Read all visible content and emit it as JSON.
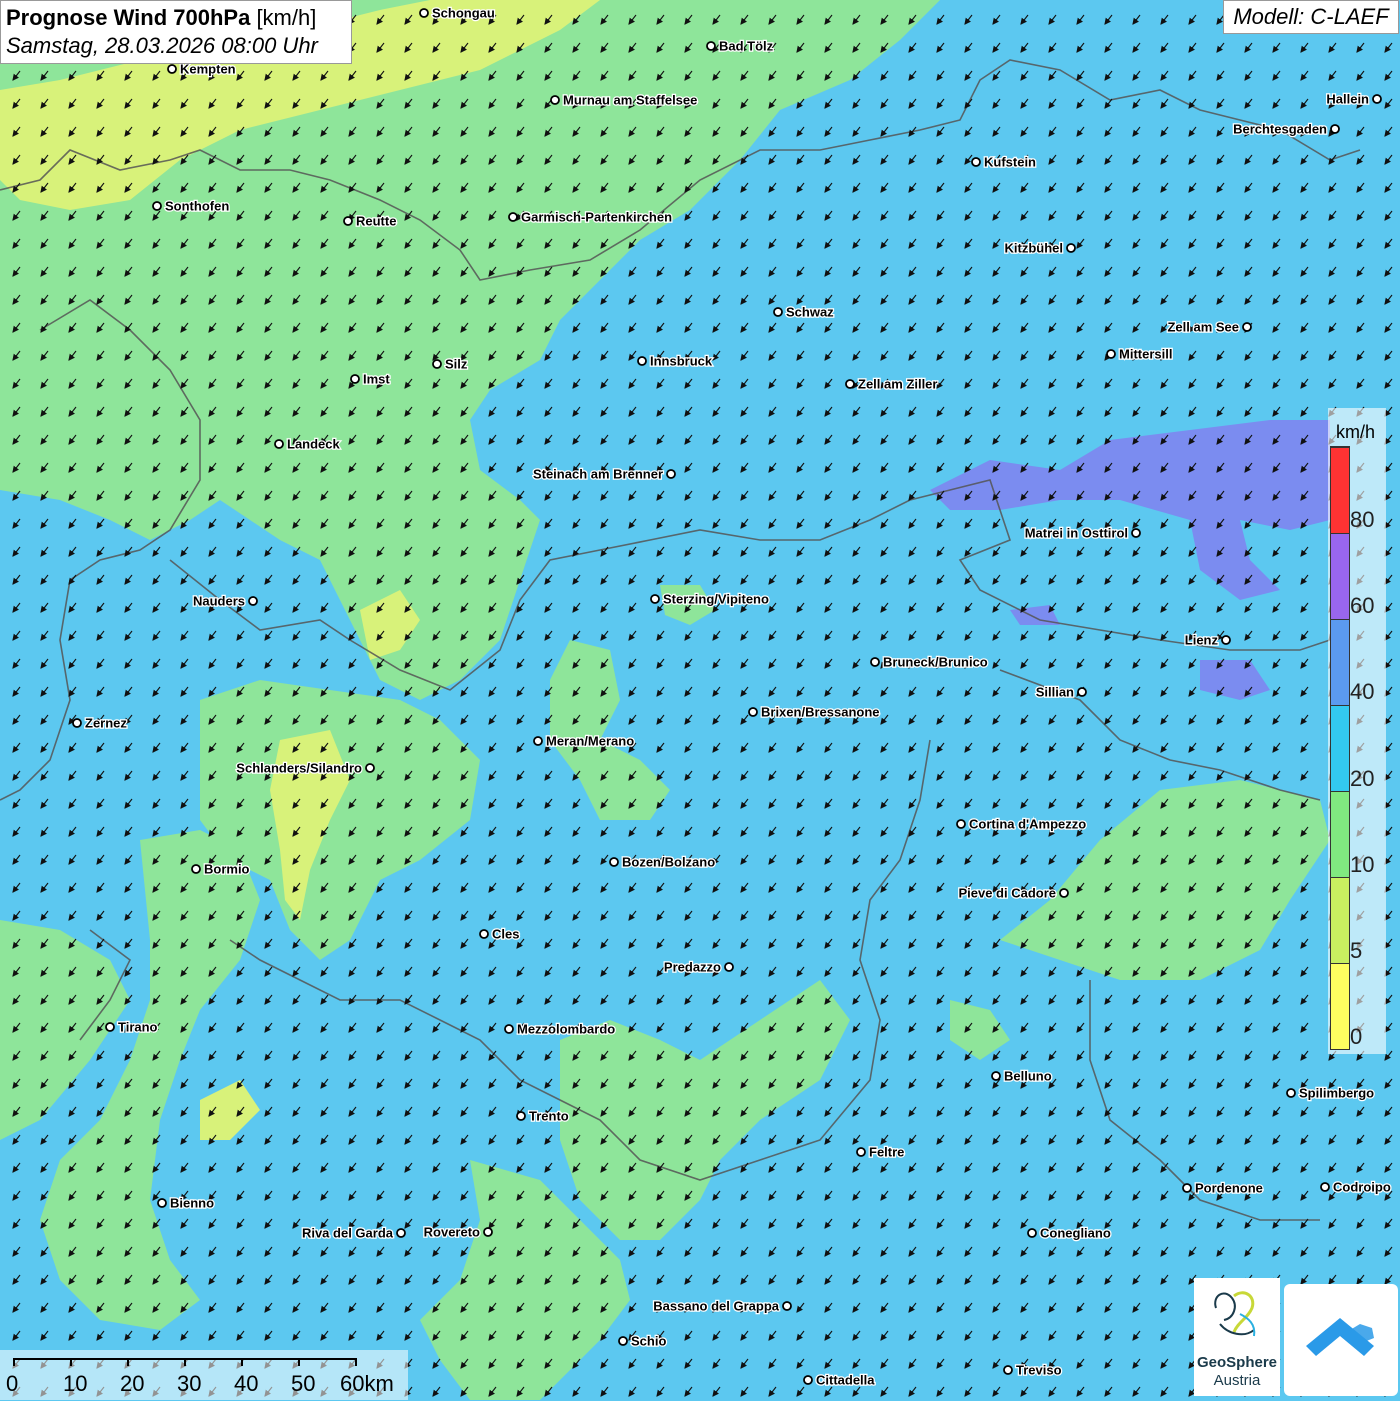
{
  "header": {
    "title_bold": "Prognose Wind 700hPa",
    "title_unit": "[km/h]",
    "datetime": "Samstag, 28.03.2026 08:00 Uhr",
    "model": "Modell: C-LAEF"
  },
  "legend": {
    "unit": "km/h",
    "labels": [
      "80",
      "60",
      "40",
      "20",
      "10",
      "5",
      "0"
    ],
    "colors": [
      "#ff3333",
      "#9966ee",
      "#5b9af0",
      "#33c8f0",
      "#80e880",
      "#c8f060",
      "#ffff60"
    ]
  },
  "scale_bar": {
    "labels": [
      "0",
      "10",
      "20",
      "30",
      "40",
      "50",
      "60km"
    ]
  },
  "logo": {
    "line1": "GeoSphere",
    "line2": "Austria"
  },
  "colors": {
    "wind_10_20": "#5cc8f0",
    "wind_5_10": "#8ee59a",
    "wind_0_5": "#d8f27a",
    "wind_40_60": "#7b8cf0",
    "border": "#555555",
    "arrow": "#111111"
  },
  "cities": [
    {
      "name": "Schongau"
    },
    {
      "name": "Bad Tölz"
    },
    {
      "name": "Kempten"
    },
    {
      "name": "Murnau am Staffelsee"
    },
    {
      "name": "Hallein"
    },
    {
      "name": "Berchtesgaden"
    },
    {
      "name": "Kufstein"
    },
    {
      "name": "Sonthofen"
    },
    {
      "name": "Reutte"
    },
    {
      "name": "Garmisch-Partenkirchen"
    },
    {
      "name": "Kitzbühel"
    },
    {
      "name": "Schwaz"
    },
    {
      "name": "Zell am See"
    },
    {
      "name": "Mittersill"
    },
    {
      "name": "Innsbruck"
    },
    {
      "name": "Silz"
    },
    {
      "name": "Imst"
    },
    {
      "name": "Zell am Ziller"
    },
    {
      "name": "Landeck"
    },
    {
      "name": "Steinach am Brenner"
    },
    {
      "name": "Matrei in Osttirol"
    },
    {
      "name": "Nauders"
    },
    {
      "name": "Sterzing/Vipiteno"
    },
    {
      "name": "Lienz"
    },
    {
      "name": "Bruneck/Brunico"
    },
    {
      "name": "Sillian"
    },
    {
      "name": "Brixen/Bressanone"
    },
    {
      "name": "Zernez"
    },
    {
      "name": "Meran/Merano"
    },
    {
      "name": "Schlanders/Silandro"
    },
    {
      "name": "Cortina d'Ampezzo"
    },
    {
      "name": "Bozen/Bolzano"
    },
    {
      "name": "Bormio"
    },
    {
      "name": "Pieve di Cadore"
    },
    {
      "name": "Cles"
    },
    {
      "name": "Predazzo"
    },
    {
      "name": "Tirano"
    },
    {
      "name": "Mezzolombardo"
    },
    {
      "name": "Belluno"
    },
    {
      "name": "Spilimbergo"
    },
    {
      "name": "Trento"
    },
    {
      "name": "Feltre"
    },
    {
      "name": "Pordenone"
    },
    {
      "name": "Codroipo"
    },
    {
      "name": "Bienno"
    },
    {
      "name": "Riva del Garda"
    },
    {
      "name": "Rovereto"
    },
    {
      "name": "Conegliano"
    },
    {
      "name": "Bassano del Grappa"
    },
    {
      "name": "Schio"
    },
    {
      "name": "Treviso"
    },
    {
      "name": "Cittadella"
    }
  ]
}
